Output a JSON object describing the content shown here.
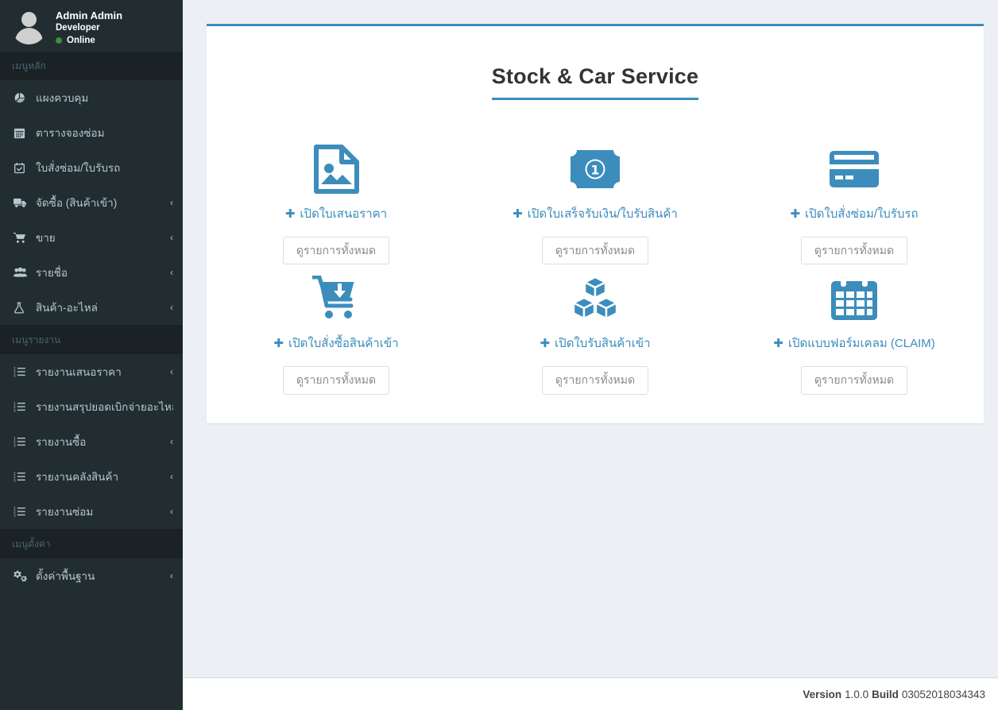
{
  "sidebar": {
    "user": {
      "name": "Admin Admin",
      "role": "Developer",
      "status": "Online",
      "avatar_icon": "user-avatar-icon",
      "status_color": "#3c8f3c"
    },
    "sections": [
      {
        "header": "เมนูหลัก",
        "items": [
          {
            "label": "แผงควบคุม",
            "icon": "pie-chart-icon",
            "arrow": ""
          },
          {
            "label": "ตารางจองซ่อม",
            "icon": "calendar-grid-icon",
            "arrow": ""
          },
          {
            "label": "ใบสั่งซ่อม/ใบรับรถ",
            "icon": "calendar-check-icon",
            "arrow": ""
          },
          {
            "label": "จัดซื้อ (สินค้าเข้า)",
            "icon": "truck-icon",
            "arrow": "‹"
          },
          {
            "label": "ขาย",
            "icon": "shopping-cart-icon",
            "arrow": "‹"
          },
          {
            "label": "รายชื่อ",
            "icon": "users-icon",
            "arrow": "‹"
          },
          {
            "label": "สินค้า-อะไหล่",
            "icon": "flask-icon",
            "arrow": "‹"
          }
        ]
      },
      {
        "header": "เมนูรายงาน",
        "items": [
          {
            "label": "รายงานเสนอราคา",
            "icon": "list-ol-icon",
            "arrow": "‹"
          },
          {
            "label": "รายงานสรุปยอดเบิกจ่ายอะไหล่",
            "icon": "list-ol-icon",
            "arrow": ""
          },
          {
            "label": "รายงานซื้อ",
            "icon": "list-ol-icon",
            "arrow": "‹"
          },
          {
            "label": "รายงานคลังสินค้า",
            "icon": "list-ol-icon",
            "arrow": "‹"
          },
          {
            "label": "รายงานซ่อม",
            "icon": "list-ol-icon",
            "arrow": "‹"
          }
        ]
      },
      {
        "header": "เมนูตั้งค่า",
        "items": [
          {
            "label": "ตั้งค่าพื้นฐาน",
            "icon": "gears-icon",
            "arrow": "‹"
          }
        ]
      }
    ]
  },
  "main": {
    "panel_title": "Stock & Car Service",
    "accent_color": "#3c8dbc",
    "cards": [
      {
        "icon": "file-image-icon",
        "link_label": "เปิดใบเสนอราคา",
        "plus": "✚",
        "button_label": "ดูรายการทั้งหมด"
      },
      {
        "icon": "money-bill-icon",
        "link_label": "เปิดใบเสร็จรับเงิน/ใบรับสินค้า",
        "plus": "✚",
        "button_label": "ดูรายการทั้งหมด"
      },
      {
        "icon": "credit-card-icon",
        "link_label": "เปิดใบสั่งซ่อม/ใบรับรถ",
        "plus": "✚",
        "button_label": "ดูรายการทั้งหมด"
      },
      {
        "icon": "cart-arrow-down-icon",
        "link_label": "เปิดใบสั่งซื้อสินค้าเข้า",
        "plus": "✚",
        "button_label": "ดูรายการทั้งหมด"
      },
      {
        "icon": "cubes-icon",
        "link_label": "เปิดใบรับสินค้าเข้า",
        "plus": "✚",
        "button_label": "ดูรายการทั้งหมด"
      },
      {
        "icon": "calendar-icon",
        "link_label": "เปิดแบบฟอร์มเคลม (CLAIM)",
        "plus": "✚",
        "button_label": "ดูรายการทั้งหมด"
      }
    ]
  },
  "footer": {
    "version_label": "Version",
    "version_value": "1.0.0",
    "build_label": "Build",
    "build_value": "03052018034343"
  }
}
